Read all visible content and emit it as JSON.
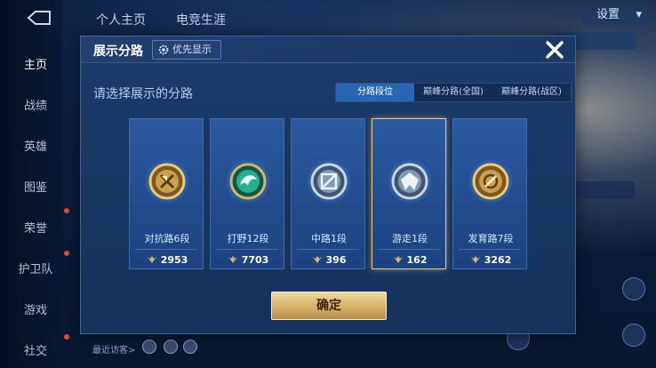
{
  "background": {
    "nav_items": [
      {
        "label": "主页",
        "active": true
      },
      {
        "label": "战绩"
      },
      {
        "label": "英雄"
      },
      {
        "label": "图鉴"
      },
      {
        "label": "荣誉"
      },
      {
        "label": "护卫队"
      },
      {
        "label": "游戏"
      },
      {
        "label": "社交"
      }
    ],
    "top_tabs": [
      "个人主页",
      "电竞生涯"
    ],
    "settings_label": "设置",
    "recent_visit": "最近访客>"
  },
  "modal": {
    "title": "展示分路",
    "priority_label": "优先显示",
    "subtitle": "请选择展示的分路",
    "tabs": [
      {
        "label": "分路段位",
        "active": true
      },
      {
        "label": "巅峰分路(全国)"
      },
      {
        "label": "巅峰分路(战区)"
      }
    ],
    "cards": [
      {
        "name": "对抗路6段",
        "score": "2953",
        "emblem": "clash-lane-emblem-icon",
        "color": "#d8a94a"
      },
      {
        "name": "打野12段",
        "score": "7703",
        "emblem": "jungle-emblem-icon",
        "color": "#2fb89a"
      },
      {
        "name": "中路1段",
        "score": "396",
        "emblem": "mid-lane-emblem-icon",
        "color": "#9fb6d6"
      },
      {
        "name": "游走1段",
        "score": "162",
        "emblem": "roam-emblem-icon",
        "color": "#9fb6d6",
        "selected": true
      },
      {
        "name": "发育路7段",
        "score": "3262",
        "emblem": "farm-lane-emblem-icon",
        "color": "#d8a94a"
      }
    ],
    "confirm_label": "确定"
  },
  "colors": {
    "accent": "#2a66b6",
    "gold": "#d8b36a",
    "card": "#2b5aa0"
  }
}
